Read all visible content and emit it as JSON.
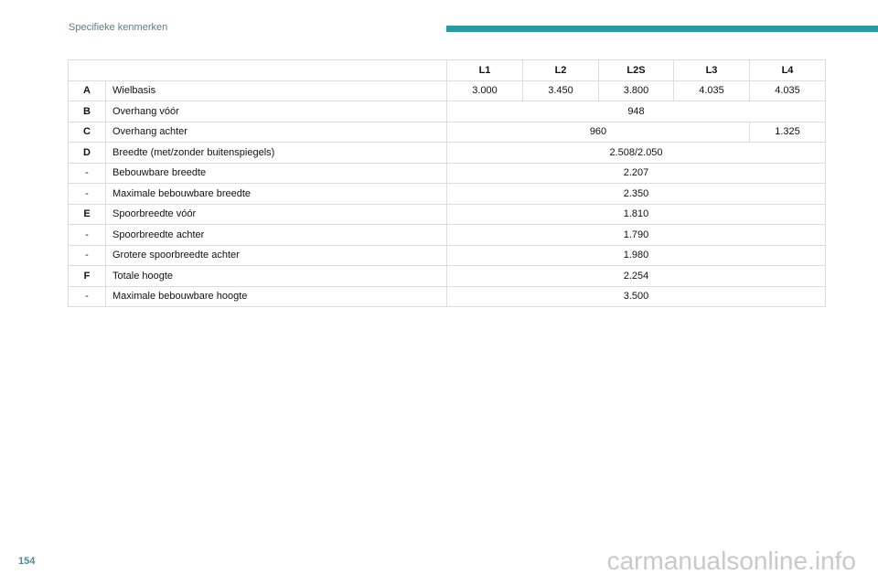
{
  "header": {
    "section_title": "Specifieke kenmerken",
    "accent_color": "#2a9aa0"
  },
  "table": {
    "columns": [
      "L1",
      "L2",
      "L2S",
      "L3",
      "L4"
    ],
    "rows": [
      {
        "code": "A",
        "label": "Wielbasis",
        "values": [
          "3.000",
          "3.450",
          "3.800",
          "4.035",
          "4.035"
        ]
      },
      {
        "code": "B",
        "label": "Overhang vóór",
        "values": [
          "948"
        ]
      },
      {
        "code": "C",
        "label": "Overhang achter",
        "values": [
          "960",
          "1.325"
        ]
      },
      {
        "code": "D",
        "label": "Breedte (met/zonder buitenspiegels)",
        "values": [
          "2.508/2.050"
        ]
      },
      {
        "code": "-",
        "label": "Bebouwbare breedte",
        "values": [
          "2.207"
        ]
      },
      {
        "code": "-",
        "label": "Maximale bebouwbare breedte",
        "values": [
          "2.350"
        ]
      },
      {
        "code": "E",
        "label": "Spoorbreedte vóór",
        "values": [
          "1.810"
        ]
      },
      {
        "code": "-",
        "label": "Spoorbreedte achter",
        "values": [
          "1.790"
        ]
      },
      {
        "code": "-",
        "label": "Grotere spoorbreedte achter",
        "values": [
          "1.980"
        ]
      },
      {
        "code": "F",
        "label": "Totale hoogte",
        "values": [
          "2.254"
        ]
      },
      {
        "code": "-",
        "label": "Maximale bebouwbare hoogte",
        "values": [
          "3.500"
        ]
      }
    ]
  },
  "footer": {
    "page_number": "154",
    "watermark": "carmanualsonline.info"
  }
}
